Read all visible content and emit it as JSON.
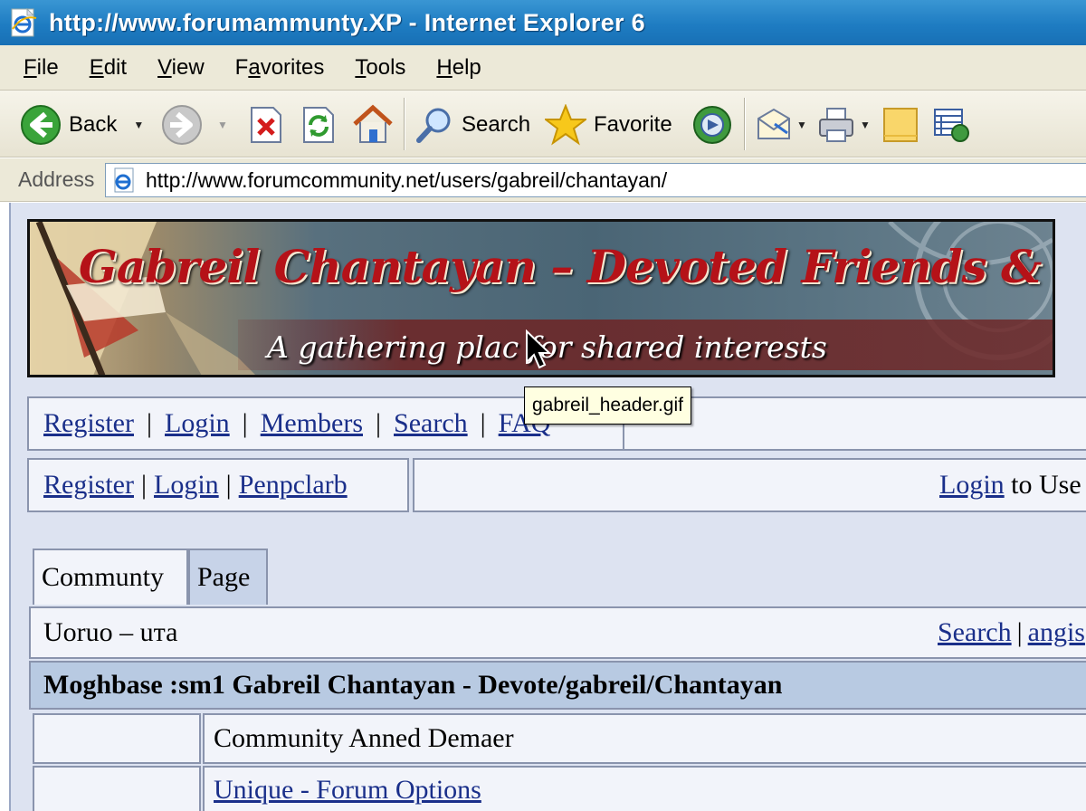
{
  "window": {
    "title": "http://www.forumammunty.XP - Internet Explorer 6"
  },
  "menu": [
    "File",
    "Edit",
    "View",
    "Favorites",
    "Tools",
    "Help"
  ],
  "menu_underline": [
    "F",
    "E",
    "V",
    "a",
    "T",
    "H"
  ],
  "toolbar": {
    "back_label": "Back",
    "search_label": "Search",
    "favorites_label": "Favorite"
  },
  "address": {
    "label": "Address",
    "url": "http://www.forumcommunity.net/users/gabreil/chantayan/"
  },
  "banner": {
    "title": "Gabreil Chantayan – Devoted Friends & Followers",
    "subtitle": "A gathering plac for shared interests",
    "tooltip": "gabreil_header.gif"
  },
  "nav": {
    "links": [
      "Register",
      "Login",
      "Members",
      "Search",
      "FAQ"
    ]
  },
  "row2": {
    "links": [
      "Register",
      "Login",
      "Penpclarb"
    ],
    "login_link": "Login",
    "login_suffix": "to Use"
  },
  "tabs": [
    "Communty",
    "Page"
  ],
  "info_bar": {
    "left_text": "Uoruo – uта",
    "search_link": "Search",
    "right_link": "angis"
  },
  "heading_bar": {
    "text": "Moghbase :sm1 Gabreil Chantayan - Devote/gabreil/Chantayan"
  },
  "table": {
    "row1_text": "Community Anned Demaer",
    "row2_link": "Unique - Forum Options"
  }
}
